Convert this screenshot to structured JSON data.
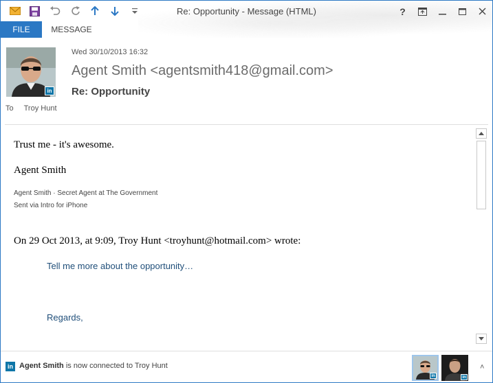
{
  "window": {
    "title": "Re: Opportunity - Message (HTML)",
    "help": "?",
    "minimize": "—",
    "maximize": "▢",
    "close": "✕"
  },
  "ribbon": {
    "file_tab": "FILE",
    "message_tab": "MESSAGE"
  },
  "header": {
    "sent": "Wed 30/10/2013 16:32",
    "sender": "Agent Smith <agentsmith418@gmail.com>",
    "subject": "Re: Opportunity",
    "to_label": "To",
    "to_name": "Troy Hunt"
  },
  "body": {
    "line1": "Trust me - it's awesome.",
    "line2": "Agent Smith",
    "sig1": "Agent Smith · Secret Agent at The Government",
    "sig2": "Sent via Intro for iPhone",
    "wrote": "On 29 Oct 2013, at 9:09, Troy Hunt <troyhunt@hotmail.com> wrote:",
    "quote1": "Tell me more about the opportunity…",
    "quote2": "Regards,"
  },
  "people_pane": {
    "li_icon": "in",
    "name": "Agent Smith",
    "message": " is now connected to Troy Hunt",
    "expand": "˄"
  },
  "badges": {
    "linkedin": "in"
  },
  "icons": [
    "mail-icon",
    "save-icon",
    "undo-icon",
    "redo-icon",
    "up-arrow-icon",
    "down-arrow-icon",
    "customize-icon",
    "help-icon",
    "restore-icon",
    "minimize-icon",
    "maximize-icon",
    "close-icon"
  ],
  "colors": {
    "accent": "#2b78c4",
    "linkedin": "#0e76a8",
    "quote_text": "#1f4e79"
  }
}
